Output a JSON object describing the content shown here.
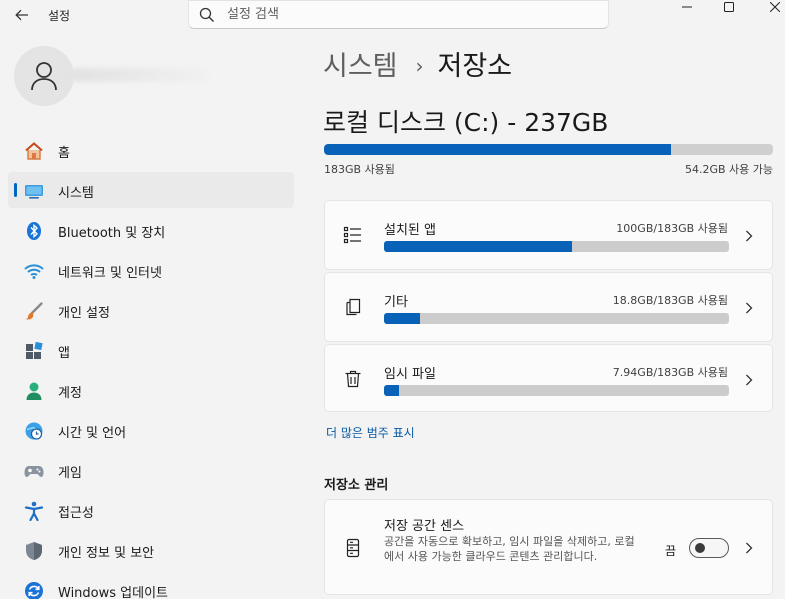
{
  "titlebar": {
    "app_title": "설정",
    "search_placeholder": "설정 검색"
  },
  "sidebar": {
    "items": [
      {
        "label": "홈",
        "icon": "home-icon",
        "active": false
      },
      {
        "label": "시스템",
        "icon": "system-icon",
        "active": true
      },
      {
        "label": "Bluetooth 및 장치",
        "icon": "bluetooth-icon",
        "active": false
      },
      {
        "label": "네트워크 및 인터넷",
        "icon": "wifi-icon",
        "active": false
      },
      {
        "label": "개인 설정",
        "icon": "brush-icon",
        "active": false
      },
      {
        "label": "앱",
        "icon": "apps-icon",
        "active": false
      },
      {
        "label": "계정",
        "icon": "account-icon",
        "active": false
      },
      {
        "label": "시간 및 언어",
        "icon": "globe-clock-icon",
        "active": false
      },
      {
        "label": "게임",
        "icon": "gamepad-icon",
        "active": false
      },
      {
        "label": "접근성",
        "icon": "accessibility-icon",
        "active": false
      },
      {
        "label": "개인 정보 및 보안",
        "icon": "shield-icon",
        "active": false
      },
      {
        "label": "Windows 업데이트",
        "icon": "update-icon",
        "active": false
      }
    ]
  },
  "main": {
    "breadcrumb_parent": "시스템",
    "breadcrumb_separator": "›",
    "breadcrumb_current": "저장소",
    "disk": {
      "title": "로컬 디스크 (C:) - 237GB",
      "used_label": "183GB 사용됨",
      "free_label": "54.2GB 사용 가능",
      "used_fraction": 0.772
    },
    "categories": [
      {
        "title": "설치된 앱",
        "meta": "100GB/183GB 사용됨",
        "fraction": 0.546,
        "icon": "list-icon"
      },
      {
        "title": "기타",
        "meta": "18.8GB/183GB 사용됨",
        "fraction": 0.103,
        "icon": "files-icon"
      },
      {
        "title": "임시 파일",
        "meta": "7.94GB/183GB 사용됨",
        "fraction": 0.043,
        "icon": "trash-icon"
      }
    ],
    "more_link": "더 많은 범주 표시",
    "management_header": "저장소 관리",
    "storage_sense": {
      "title": "저장 공간 센스",
      "description": "공간을 자동으로 확보하고, 임시 파일을 삭제하고, 로컬에서 사용 가능한 클라우드 콘텐츠 관리합니다.",
      "toggle_label": "끔",
      "icon": "drive-icon"
    }
  },
  "colors": {
    "accent": "#0067c0",
    "bar_fill": "#0a62b8",
    "bar_track": "#cccccc"
  }
}
